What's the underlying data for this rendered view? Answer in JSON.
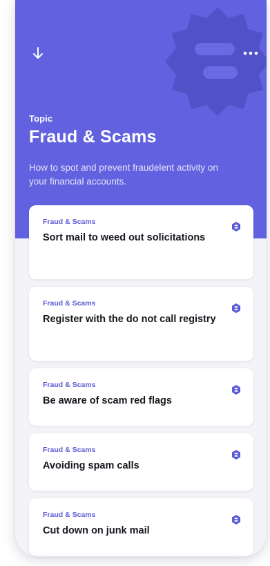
{
  "colors": {
    "hero_bg": "#6262e0",
    "accent": "#5b5bd6",
    "card_bg": "#ffffff",
    "page_bg": "#f4f3f8",
    "title_text": "#17171f"
  },
  "topbar": {
    "back_icon": "arrow-down-icon",
    "menu_icon": "more-horizontal-icon"
  },
  "header": {
    "eyebrow": "Topic",
    "title": "Fraud & Scams",
    "description": "How to spot and prevent fraudelent activity on your financial accounts.",
    "watermark_icon": "shield-badge-icon"
  },
  "cards": [
    {
      "category": "Fraud & Scams",
      "title": "Sort mail to weed out solicitations",
      "icon": "badge-icon"
    },
    {
      "category": "Fraud & Scams",
      "title": "Register with the do not call registry",
      "icon": "badge-icon"
    },
    {
      "category": "Fraud & Scams",
      "title": "Be aware of scam red flags",
      "icon": "badge-icon"
    },
    {
      "category": "Fraud & Scams",
      "title": "Avoiding spam calls",
      "icon": "badge-icon"
    },
    {
      "category": "Fraud & Scams",
      "title": "Cut down on junk mail",
      "icon": "badge-icon"
    }
  ]
}
